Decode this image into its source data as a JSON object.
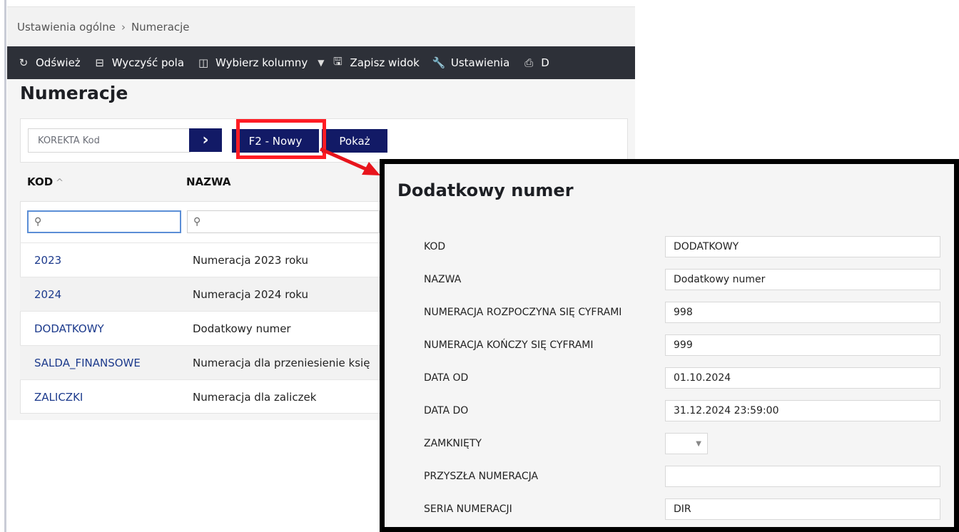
{
  "breadcrumb": {
    "root": "Ustawienia ogólne",
    "separator": "›",
    "current": "Numeracje"
  },
  "toolbar": {
    "refresh": "Odśwież",
    "clear": "Wyczyść pola",
    "columns": "Wybierz kolumny",
    "save_view": "Zapisz widok",
    "settings": "Ustawienia",
    "print": "D"
  },
  "page": {
    "title": "Numeracje"
  },
  "filter": {
    "placeholder": "KOREKTA Kod",
    "go": "›",
    "new_button": "F2 - Nowy",
    "show_button": "Pokaż"
  },
  "table": {
    "headers": {
      "kod": "KOD",
      "kod_sort": "^",
      "nazwa": "NAZWA"
    },
    "rows": [
      {
        "kod": "2023",
        "nazwa": "Numeracja 2023 roku"
      },
      {
        "kod": "2024",
        "nazwa": "Numeracja 2024 roku"
      },
      {
        "kod": "DODATKOWY",
        "nazwa": "Dodatkowy numer"
      },
      {
        "kod": "SALDA_FINANSOWE",
        "nazwa": "Numeracja dla przeniesienie księ"
      },
      {
        "kod": "ZALICZKI",
        "nazwa": "Numeracja dla zaliczek"
      }
    ]
  },
  "dialog": {
    "title": "Dodatkowy numer",
    "fields": [
      {
        "label": "KOD",
        "value": "DODATKOWY"
      },
      {
        "label": "NAZWA",
        "value": "Dodatkowy numer"
      },
      {
        "label": "NUMERACJA ROZPOCZYNA SIĘ CYFRAMI",
        "value": "998"
      },
      {
        "label": "NUMERACJA KOŃCZY SIĘ CYFRAMI",
        "value": "999"
      },
      {
        "label": "DATA OD",
        "value": "01.10.2024"
      },
      {
        "label": "DATA DO",
        "value": "31.12.2024 23:59:00"
      },
      {
        "label": "ZAMKNIĘTY",
        "value": ""
      },
      {
        "label": "PRZYSZŁA NUMERACJA",
        "value": ""
      },
      {
        "label": "SERIA NUMERACJI",
        "value": "DIR"
      }
    ]
  },
  "colors": {
    "accent": "#121a66",
    "toolbar": "#2d3038",
    "highlight": "#ff1c24",
    "link": "#1c3a8c"
  },
  "icons": {
    "refresh": "refresh-icon",
    "clear": "clear-icon",
    "columns": "columns-icon",
    "save": "save-icon",
    "settings": "wrench-icon",
    "print": "print-icon",
    "search": "search-icon"
  }
}
